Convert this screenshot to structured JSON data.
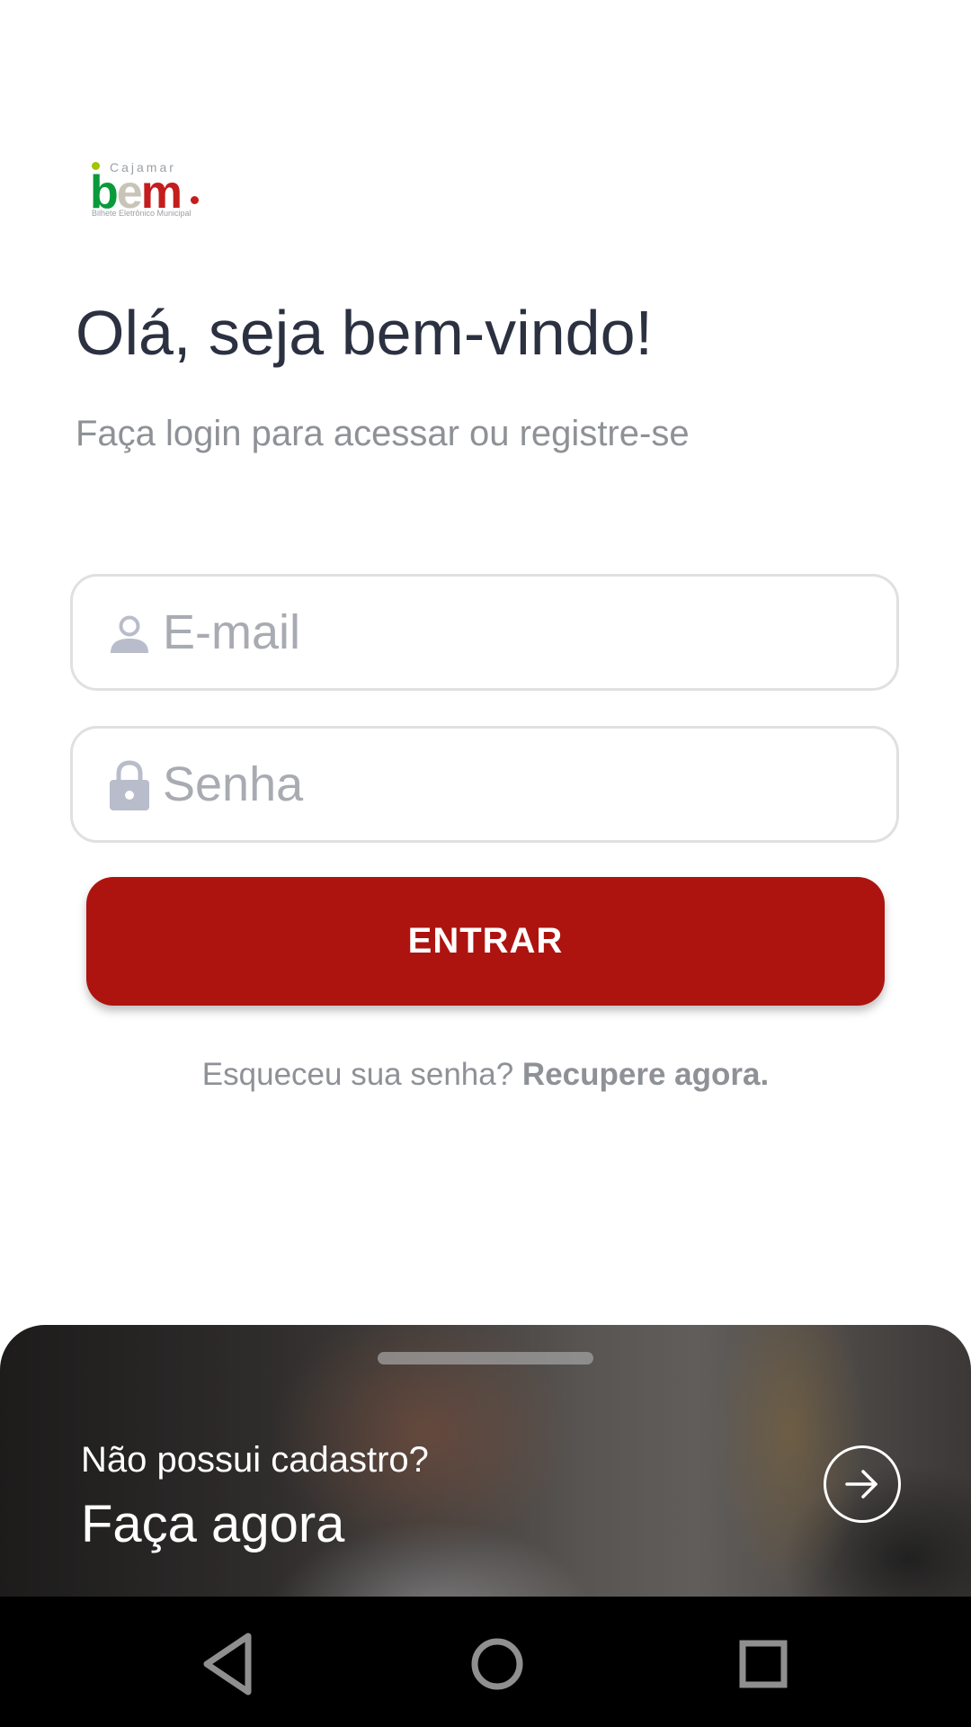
{
  "logo": {
    "top_text": "Cajamar",
    "mark_b": "b",
    "mark_e": "e",
    "mark_m": "m",
    "tagline": "Bilhete Eletrônico Municipal"
  },
  "header": {
    "title": "Olá, seja bem-vindo!",
    "subtitle": "Faça login para acessar ou registre-se"
  },
  "form": {
    "email": {
      "icon": "person-icon",
      "placeholder": "E-mail",
      "value": ""
    },
    "password": {
      "icon": "lock-icon",
      "placeholder": "Senha",
      "value": ""
    },
    "submit_label": "ENTRAR"
  },
  "forgot": {
    "text": "Esqueceu sua senha?",
    "link": "Recupere agora."
  },
  "signup_sheet": {
    "question": "Não possui cadastro?",
    "cta": "Faça agora",
    "icon": "arrow-right-circle-icon"
  },
  "colors": {
    "primary": "#ad1410",
    "title": "#2b3140",
    "muted": "#8e9196",
    "field_border": "#e0e0e3",
    "placeholder": "#a9abb3"
  },
  "system_nav": {
    "back_icon": "back-triangle-icon",
    "home_icon": "home-circle-icon",
    "recent_icon": "recent-square-icon"
  }
}
